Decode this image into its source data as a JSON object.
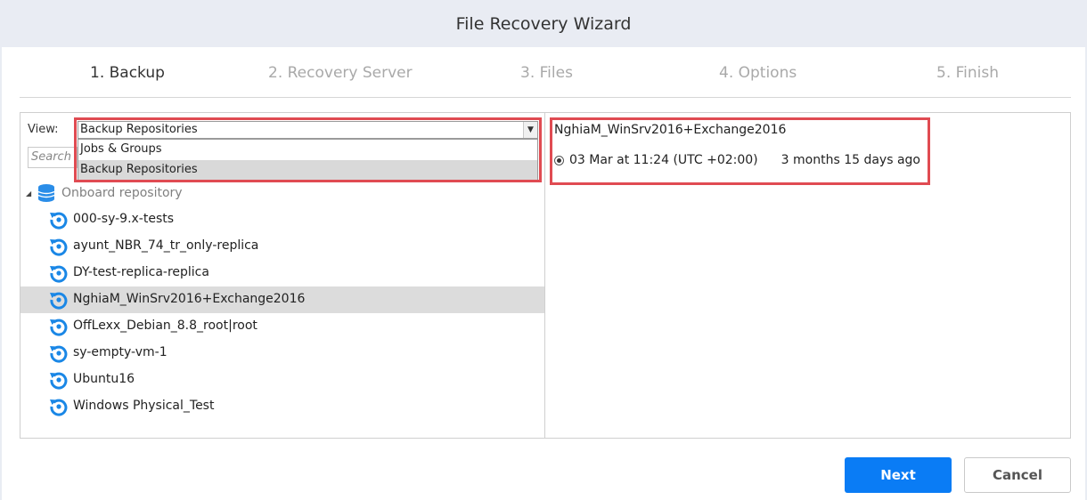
{
  "window": {
    "title": "File Recovery Wizard"
  },
  "steps": [
    {
      "label": "1. Backup",
      "active": true
    },
    {
      "label": "2. Recovery Server",
      "active": false
    },
    {
      "label": "3. Files",
      "active": false
    },
    {
      "label": "4. Options",
      "active": false
    },
    {
      "label": "5. Finish",
      "active": false
    }
  ],
  "left_panel": {
    "view_label": "View:",
    "view_selected": "Backup Repositories",
    "view_options": [
      "Jobs & Groups",
      "Backup Repositories"
    ],
    "search_placeholder": "Search",
    "root": {
      "label": "Onboard repository",
      "icon": "database-icon"
    },
    "items": [
      {
        "label": "000-sy-9.x-tests",
        "selected": false
      },
      {
        "label": "ayunt_NBR_74_tr_only-replica",
        "selected": false
      },
      {
        "label": "DY-test-replica-replica",
        "selected": false
      },
      {
        "label": "NghiaM_WinSrv2016+Exchange2016",
        "selected": true
      },
      {
        "label": "OffLexx_Debian_8.8_root|root",
        "selected": false
      },
      {
        "label": "sy-empty-vm-1",
        "selected": false
      },
      {
        "label": "Ubuntu16",
        "selected": false
      },
      {
        "label": "Windows Physical_Test",
        "selected": false
      }
    ]
  },
  "right_panel": {
    "title": "NghiaM_WinSrv2016+Exchange2016",
    "recovery_point": {
      "date": "03 Mar at 11:24 (UTC +02:00)",
      "ago": "3 months 15 days ago",
      "selected": true
    }
  },
  "buttons": {
    "next": "Next",
    "cancel": "Cancel"
  },
  "colors": {
    "accent": "#0a7cf5",
    "highlight_border": "#e04b52",
    "titlebar": "#e9ecf3",
    "selected_row": "#dcdcdc"
  }
}
